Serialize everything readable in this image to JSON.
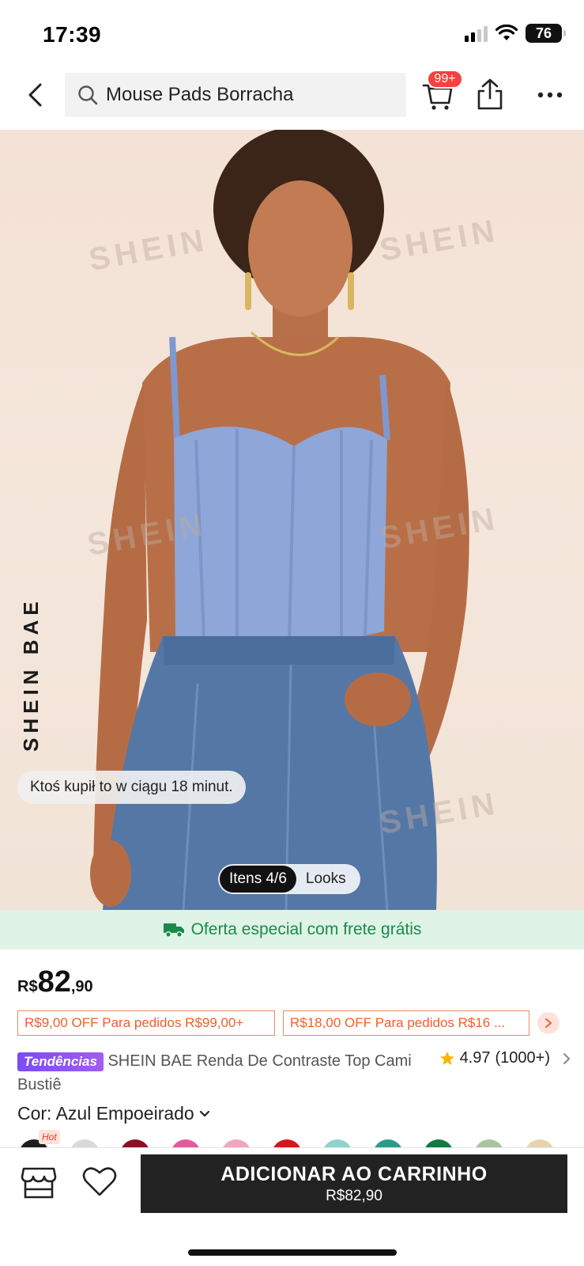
{
  "status_bar": {
    "time": "17:39",
    "battery": "76"
  },
  "header": {
    "search_query": "Mouse Pads Borracha",
    "cart_badge": "99+"
  },
  "product_image": {
    "watermark": "SHEIN",
    "brand_vertical": "SHEIN BAE",
    "social_proof": "Ktoś kupił to w ciągu 18 minut.",
    "pager": "Itens 4/6",
    "looks_label": "Looks"
  },
  "promo": {
    "text": "Oferta especial com frete grátis",
    "color": "#1a8a4c"
  },
  "price": {
    "currency": "R$",
    "integer": "82",
    "decimal": ",90"
  },
  "coupons": [
    {
      "text": "R$9,00 OFF Para pedidos R$99,00+"
    },
    {
      "text": "R$18,00 OFF Para pedidos R$16 ..."
    }
  ],
  "product": {
    "trend_badge": "Tendências",
    "title": "SHEIN BAE Renda De Contraste Top Cami Bustiê",
    "rating": "4.97",
    "reviews": "(1000+)"
  },
  "color_selector": {
    "label": "Cor: Azul Empoeirado",
    "hot_tag": "Hot",
    "swatches": [
      "#1e1e1e",
      "#d9d9d9",
      "#8b1025",
      "#e45a9c",
      "#f0a6bf",
      "#d41818",
      "#8fd3cc",
      "#2c9a8c",
      "#137a45",
      "#a9c4a0",
      "#e8d3b0"
    ]
  },
  "bottom_bar": {
    "add_to_cart": "ADICIONAR AO CARRINHO",
    "price": "R$82,90"
  }
}
